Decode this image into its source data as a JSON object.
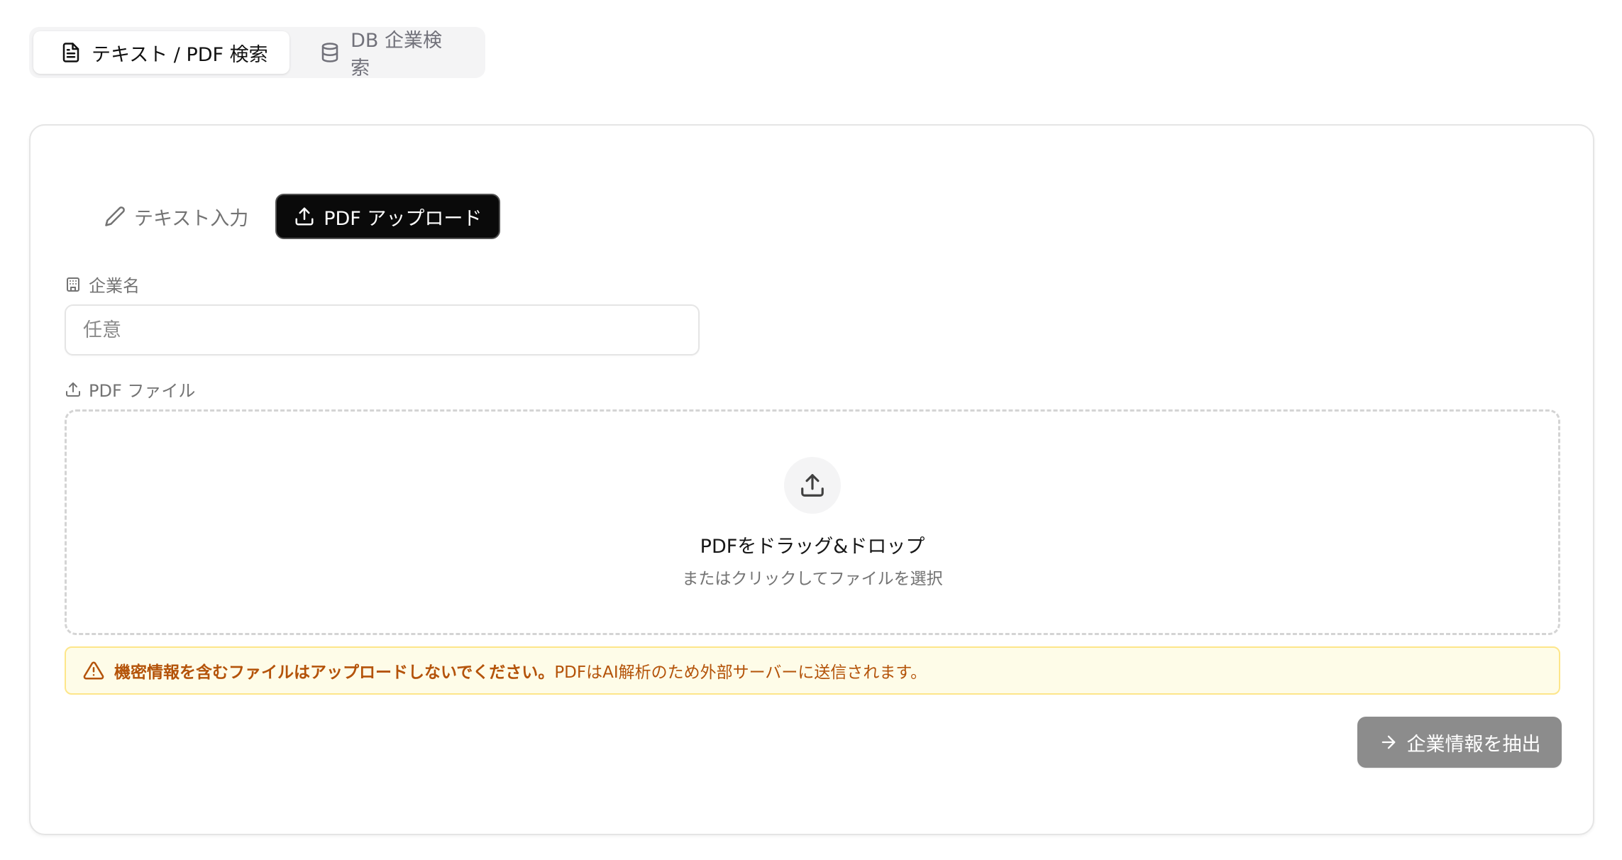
{
  "mode_tabs": [
    {
      "label": "テキスト / PDF 検索",
      "icon": "file-text-icon",
      "active": true
    },
    {
      "label": "DB 企業検索",
      "icon": "database-icon",
      "active": false
    }
  ],
  "input_tabs": [
    {
      "label": "テキスト入力",
      "icon": "pencil-icon",
      "active": false
    },
    {
      "label": "PDF アップロード",
      "icon": "upload-icon",
      "active": true
    }
  ],
  "company": {
    "label": "企業名",
    "icon": "building-icon",
    "value": "",
    "placeholder": "任意"
  },
  "pdf": {
    "label": "PDF ファイル",
    "icon": "upload-icon",
    "dropzone_title": "PDFをドラッグ&ドロップ",
    "dropzone_subtitle": "またはクリックしてファイルを選択"
  },
  "warning": {
    "icon": "alert-triangle-icon",
    "strong": "機密情報を含むファイルはアップロードしないでください。",
    "text": "PDFはAI解析のため外部サーバーに送信されます。"
  },
  "submit": {
    "label": "企業情報を抽出",
    "icon": "arrow-right-icon"
  },
  "colors": {
    "active_tab_bg": "#0a0a0a",
    "warning_bg": "#fefce8",
    "warning_border": "#fde68a",
    "warning_text": "#b45309",
    "submit_bg": "#8c8c8c"
  }
}
